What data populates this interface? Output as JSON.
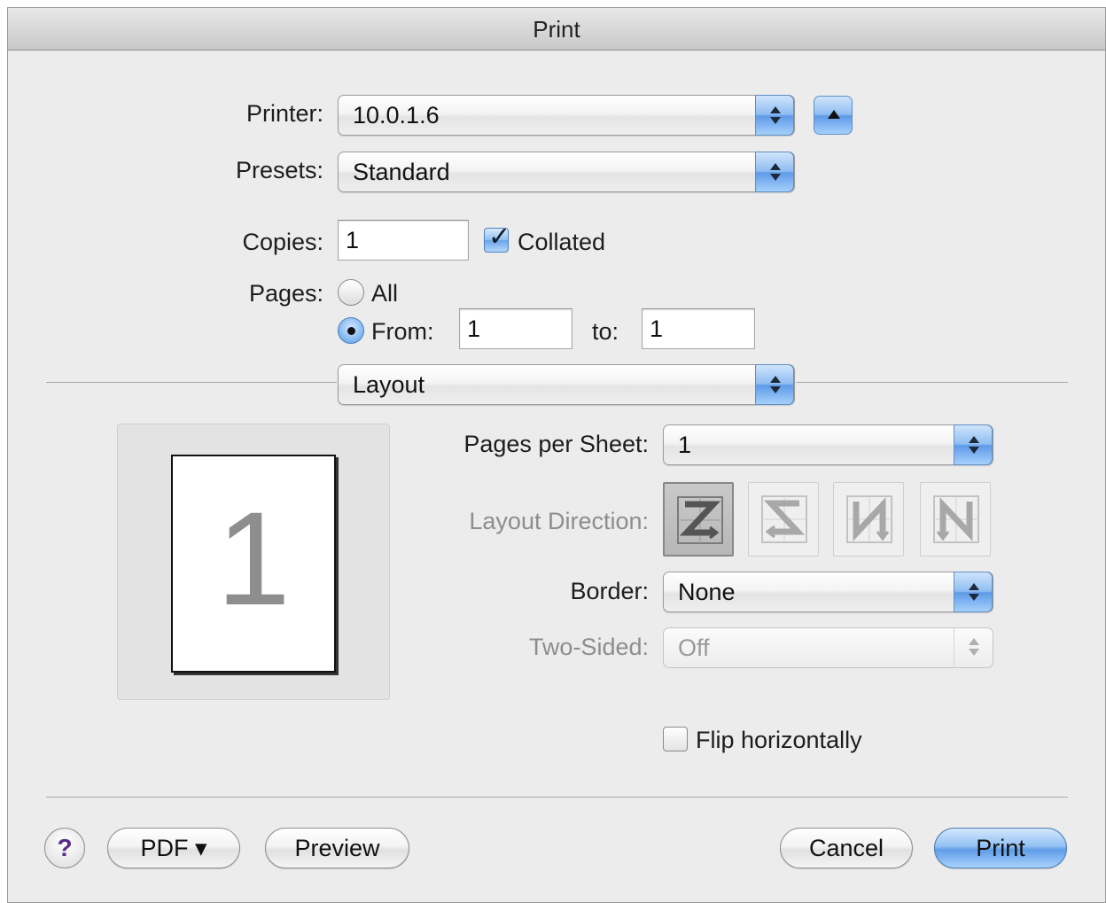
{
  "window": {
    "title": "Print"
  },
  "printer": {
    "label": "Printer:",
    "value": "10.0.1.6"
  },
  "presets": {
    "label": "Presets:",
    "value": "Standard"
  },
  "copies": {
    "label": "Copies:",
    "value": "1",
    "collated_label": "Collated",
    "collated_checked": true
  },
  "pages": {
    "label": "Pages:",
    "all_label": "All",
    "from_label": "From:",
    "from_value": "1",
    "to_label": "to:",
    "to_value": "1",
    "selected": "from"
  },
  "panel_select": {
    "value": "Layout"
  },
  "preview": {
    "page_number": "1"
  },
  "layout": {
    "pages_per_sheet_label": "Pages per Sheet:",
    "pages_per_sheet_value": "1",
    "layout_direction_label": "Layout Direction:",
    "layout_direction_icons": [
      "z-direction-icon",
      "reverse-s-direction-icon",
      "n-direction-icon",
      "reverse-n-direction-icon"
    ],
    "layout_direction_selected_index": 0,
    "border_label": "Border:",
    "border_value": "None",
    "two_sided_label": "Two-Sided:",
    "two_sided_value": "Off",
    "flip_label": "Flip horizontally",
    "flip_checked": false
  },
  "footer": {
    "help_label": "?",
    "pdf_label": "PDF ▾",
    "preview_label": "Preview",
    "cancel_label": "Cancel",
    "print_label": "Print"
  },
  "colors": {
    "accent": "#5f9ae8",
    "window_bg": "#ececec"
  }
}
